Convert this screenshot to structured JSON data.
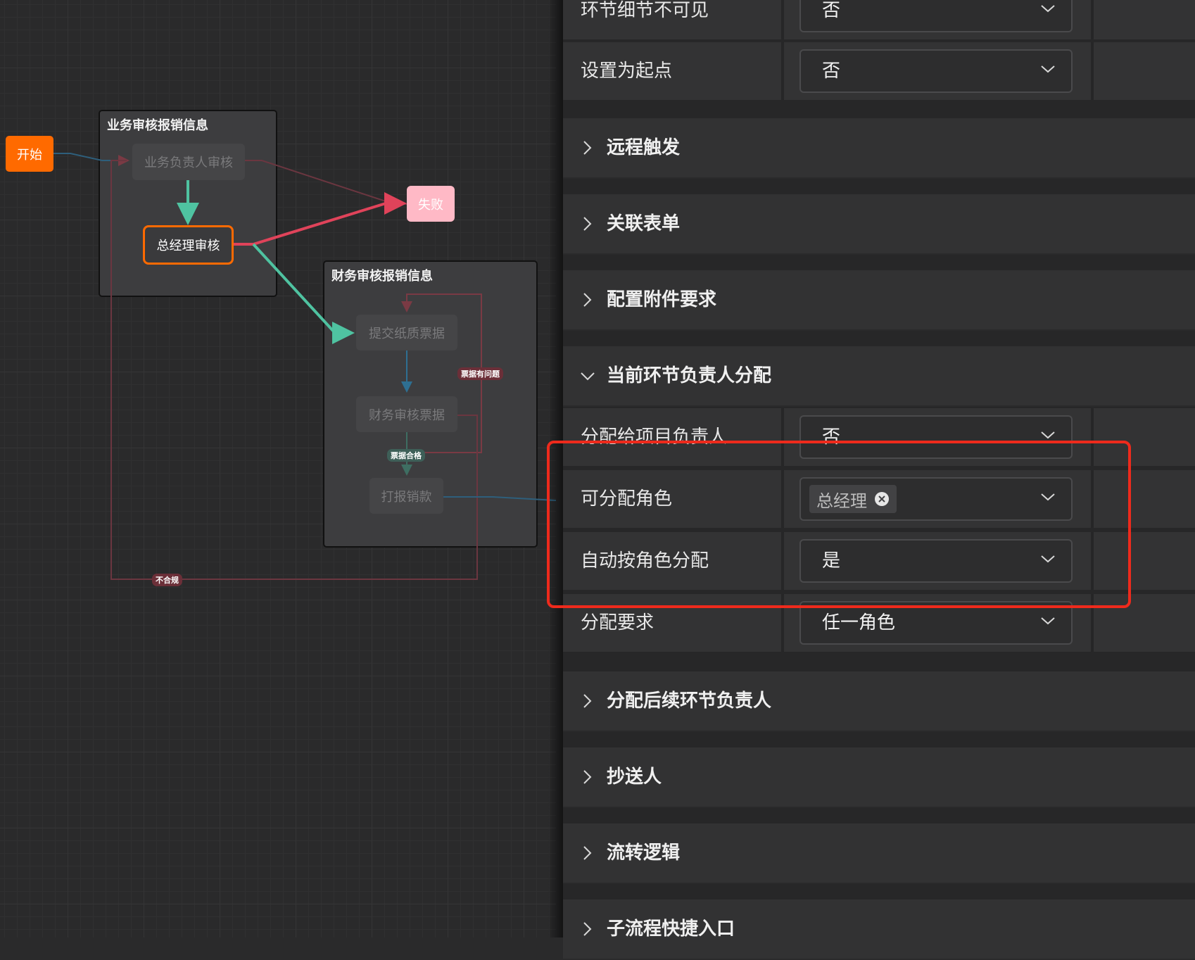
{
  "canvas": {
    "start": "开始",
    "fail": "失败",
    "group1": {
      "title": "业务审核报销信息",
      "node1": "业务负责人审核",
      "node2": "总经理审核"
    },
    "group2": {
      "title": "财务审核报销信息",
      "node1": "提交纸质票据",
      "node2": "财务审核票据",
      "node3": "打报销款"
    },
    "labels": {
      "ticket_issue": "票据有问题",
      "ticket_ok": "票据合格",
      "non_compliant": "不合规"
    },
    "colors": {
      "start": "#ff6a00",
      "fail": "#ffb9c6",
      "green_edge": "#4fc3a1",
      "red_edge": "#e0435a",
      "blue_edge": "#2e6f92"
    }
  },
  "panel": {
    "rows_top": [
      {
        "label": "环节细节不可见",
        "value": "否"
      },
      {
        "label": "设置为起点",
        "value": "否"
      }
    ],
    "sections_top": [
      {
        "title": "远程触发",
        "icon": "chevron-right-icon"
      },
      {
        "title": "关联表单",
        "icon": "chevron-right-icon"
      },
      {
        "title": "配置附件要求",
        "icon": "chevron-right-icon"
      },
      {
        "title": "当前环节负责人分配",
        "icon": "chevron-down-icon"
      }
    ],
    "assign_rows": [
      {
        "label": "分配给项目负责人",
        "value": "否"
      },
      {
        "label": "可分配角色",
        "tag": "总经理"
      },
      {
        "label": "自动按角色分配",
        "value": "是"
      },
      {
        "label": "分配要求",
        "value": "任一角色"
      }
    ],
    "sections_bottom": [
      {
        "title": "分配后续环节负责人",
        "icon": "chevron-right-icon"
      },
      {
        "title": "抄送人",
        "icon": "chevron-right-icon"
      },
      {
        "title": "流转逻辑",
        "icon": "chevron-right-icon"
      },
      {
        "title": "子流程快捷入口",
        "icon": "chevron-right-icon"
      }
    ],
    "highlight_color": "#ee2a1c"
  }
}
